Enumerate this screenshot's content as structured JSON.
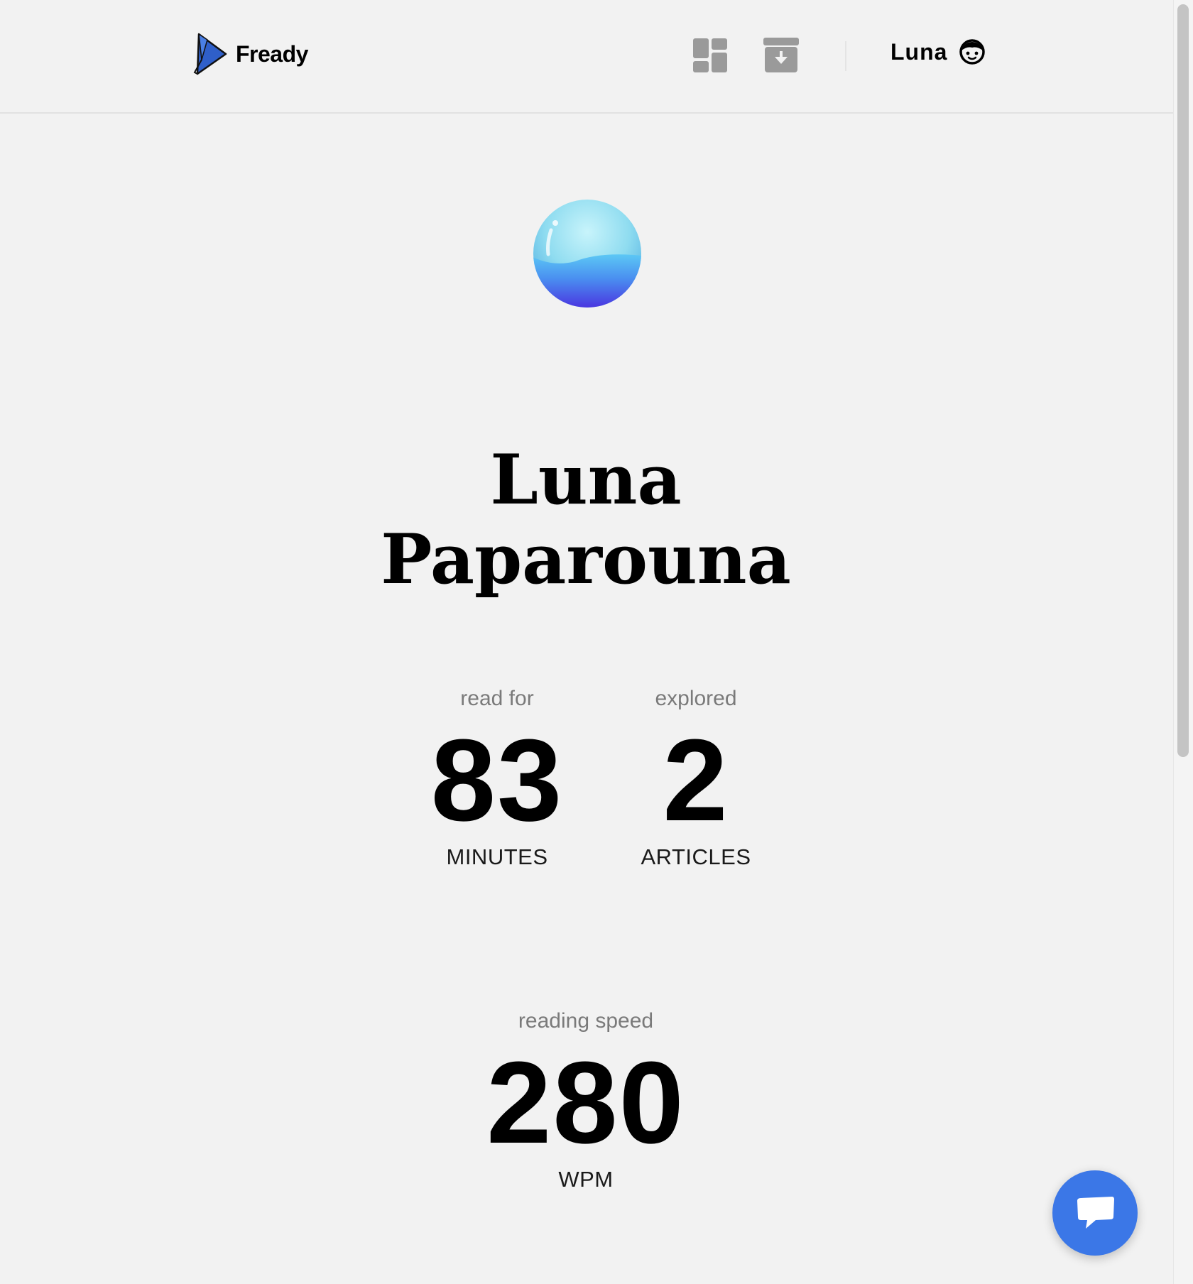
{
  "header": {
    "logo_text": "Fready",
    "nav": [
      {
        "icon": "dashboard-icon"
      },
      {
        "icon": "archive-icon"
      }
    ],
    "user_name": "Luna",
    "user_icon": "smiley-face-icon"
  },
  "profile": {
    "avatar_icon": "bubble-avatar",
    "first_name": "Luna",
    "last_name": "Paparouna"
  },
  "stats": {
    "read_for": {
      "label": "read for",
      "value": "83",
      "unit": "MINUTES"
    },
    "explored": {
      "label": "explored",
      "value": "2",
      "unit": "ARTICLES"
    },
    "reading_speed": {
      "label": "reading speed",
      "value": "280",
      "unit": "WPM"
    }
  },
  "chat": {
    "icon": "chat-bubble-icon"
  },
  "colors": {
    "background": "#f2f2f2",
    "accent": "#3b77e7",
    "muted_text": "#7a7a7a",
    "nav_icon": "#9a9a9a"
  }
}
